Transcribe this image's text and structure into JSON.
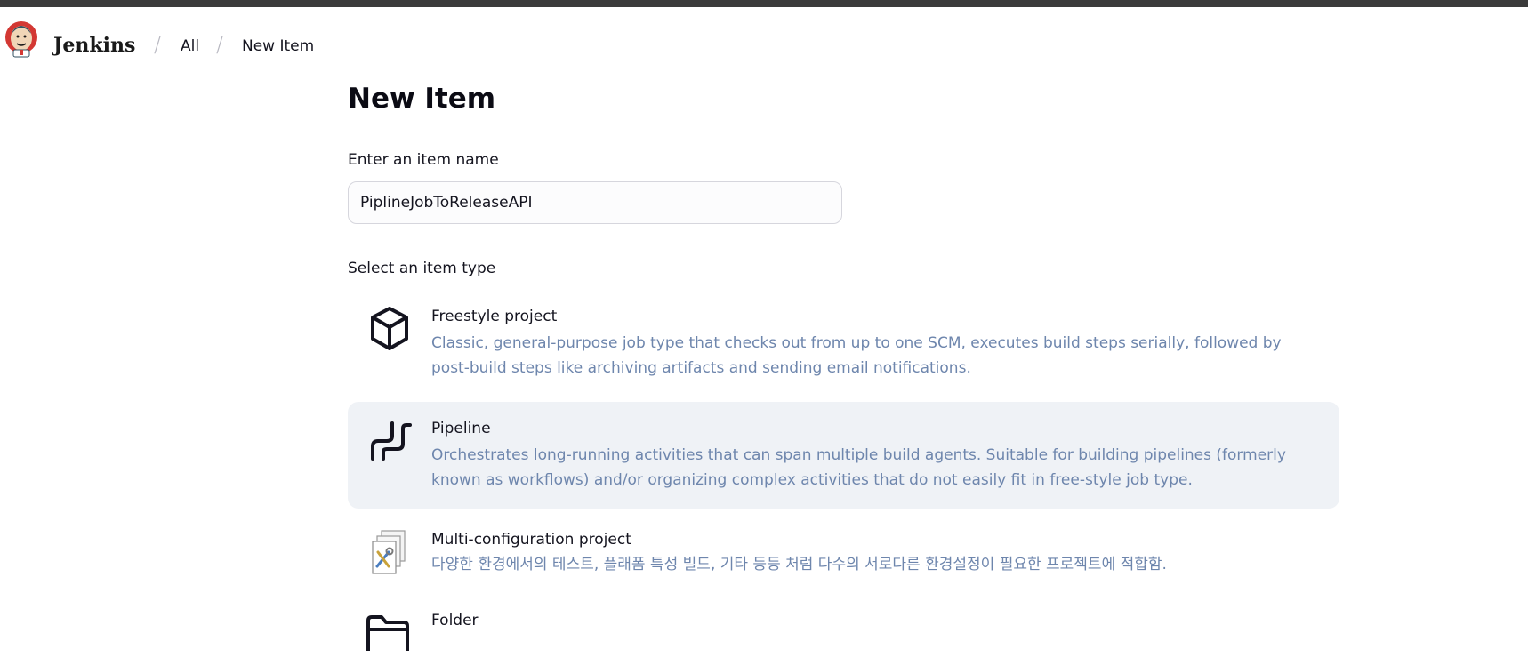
{
  "header": {
    "brand": "Jenkins",
    "breadcrumbs": [
      "All",
      "New Item"
    ],
    "separator": "/"
  },
  "page": {
    "title": "New Item",
    "name_label": "Enter an item name",
    "name_value": "PiplineJobToReleaseAPI",
    "type_label": "Select an item type"
  },
  "item_types": [
    {
      "title": "Freestyle project",
      "description": "Classic, general-purpose job type that checks out from up to one SCM, executes build steps serially, followed by post-build steps like archiving artifacts and sending email notifications.",
      "icon": "cube-icon"
    },
    {
      "title": "Pipeline",
      "description": "Orchestrates long-running activities that can span multiple build agents. Suitable for building pipelines (formerly known as workflows) and/or organizing complex activities that do not easily fit in free-style job type.",
      "icon": "pipeline-icon",
      "selected": true
    },
    {
      "title": "Multi-configuration project",
      "description": "다양한 환경에서의 테스트, 플래폼 특성 빌드, 기타 등등 처럼 다수의 서로다른 환경설정이 필요한 프로젝트에 적합함.",
      "icon": "multi-config-icon"
    },
    {
      "title": "Folder",
      "description": "",
      "icon": "folder-icon"
    }
  ],
  "colors": {
    "topbar": "#3b3b3b",
    "selected_bg": "#eff2f6",
    "description": "#6e86ad"
  }
}
